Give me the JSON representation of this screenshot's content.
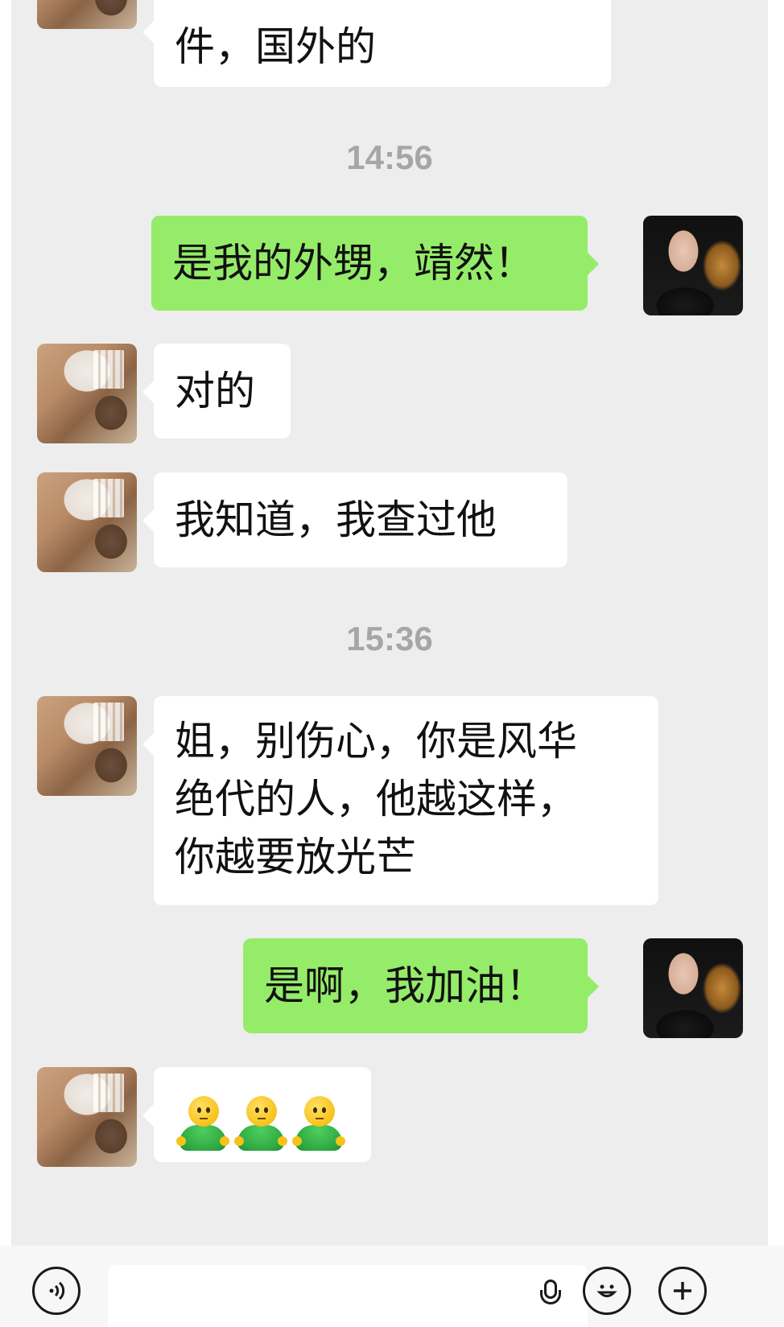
{
  "conversation": {
    "partial_message": "件，国外的",
    "timestamps": [
      "14:56",
      "15:36"
    ],
    "messages": [
      {
        "side": "out",
        "text": "是我的外甥，靖然！"
      },
      {
        "side": "in",
        "text": "对的"
      },
      {
        "side": "in",
        "text": "我知道，我查过他"
      },
      {
        "side": "in",
        "text": "姐，别伤心，你是风华\n绝代的人，他越这样，\n你越要放光芒"
      },
      {
        "side": "out",
        "text": "是啊，我加油！"
      },
      {
        "side": "in",
        "emoji": "green-figure-emoji",
        "count": 3
      }
    ]
  },
  "input_bar": {
    "voice_icon": "voice-icon",
    "mic_icon": "mic-icon",
    "emoji_icon": "smile-icon",
    "plus_icon": "plus-icon"
  },
  "colors": {
    "chat_background": "#ededed",
    "incoming_bubble": "#ffffff",
    "outgoing_bubble": "#95ec69",
    "timestamp_text": "#a6a6a6"
  }
}
